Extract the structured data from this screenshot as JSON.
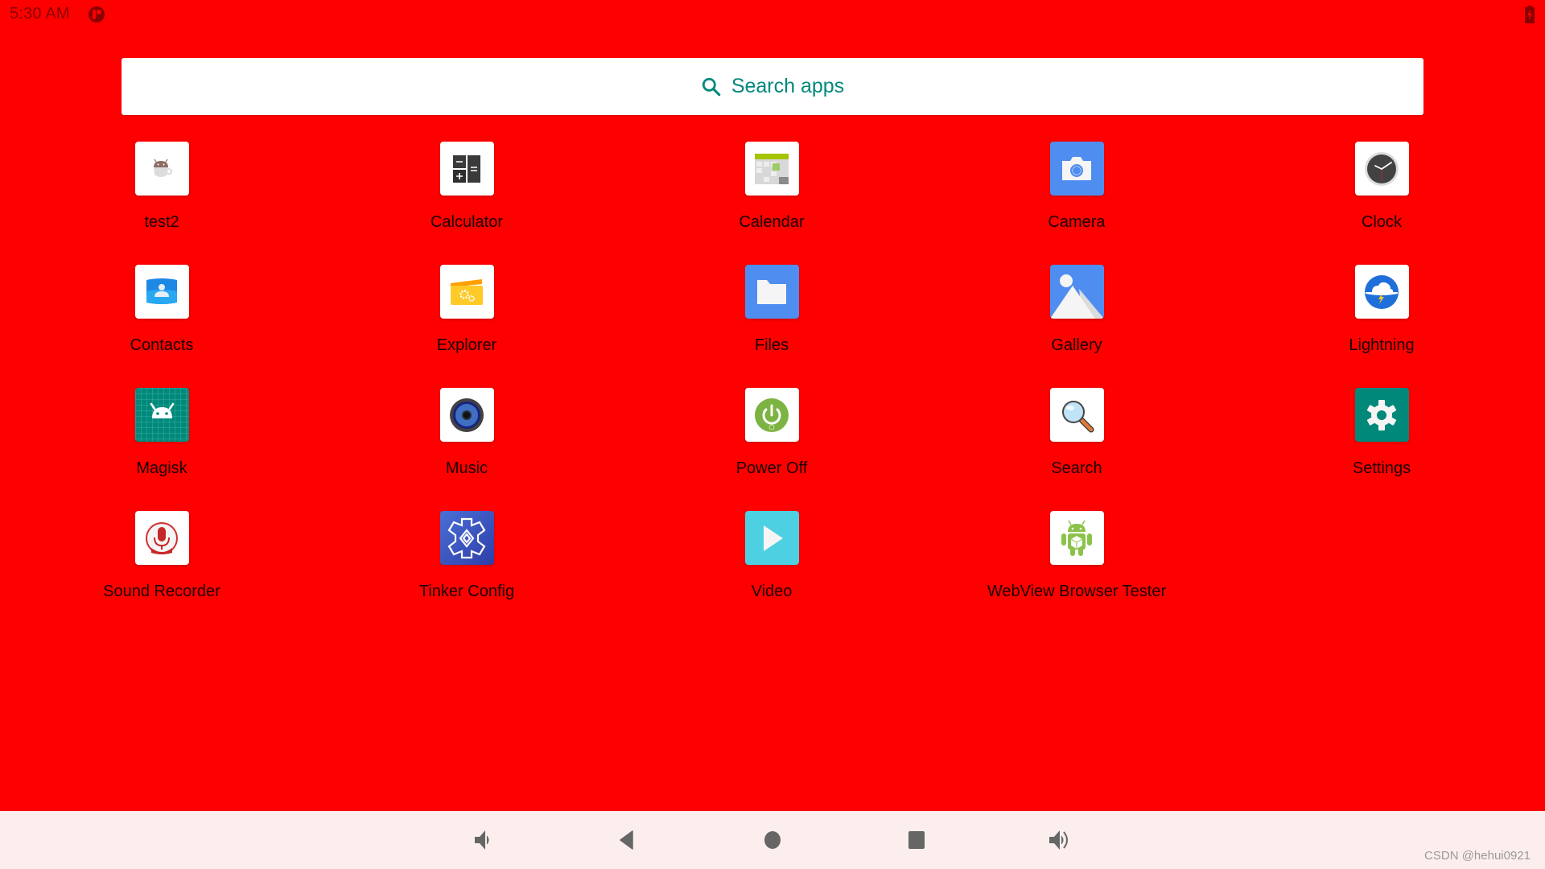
{
  "status_bar": {
    "time": "5:30 AM",
    "notification_icon": "app-notification-icon",
    "battery_icon": "battery-charging-icon"
  },
  "search": {
    "label": "Search apps",
    "icon": "search-icon"
  },
  "apps": [
    {
      "label": "test2",
      "icon": "android-cup-icon"
    },
    {
      "label": "Calculator",
      "icon": "calculator-icon"
    },
    {
      "label": "Calendar",
      "icon": "calendar-icon"
    },
    {
      "label": "Camera",
      "icon": "camera-icon"
    },
    {
      "label": "Clock",
      "icon": "clock-icon"
    },
    {
      "label": "Contacts",
      "icon": "contacts-icon"
    },
    {
      "label": "Explorer",
      "icon": "explorer-folder-icon"
    },
    {
      "label": "Files",
      "icon": "files-icon"
    },
    {
      "label": "Gallery",
      "icon": "gallery-icon"
    },
    {
      "label": "Lightning",
      "icon": "lightning-icon"
    },
    {
      "label": "Magisk",
      "icon": "magisk-icon"
    },
    {
      "label": "Music",
      "icon": "music-speaker-icon"
    },
    {
      "label": "Power Off",
      "icon": "power-icon"
    },
    {
      "label": "Search",
      "icon": "magnifier-icon"
    },
    {
      "label": "Settings",
      "icon": "settings-gear-icon"
    },
    {
      "label": "Sound Recorder",
      "icon": "microphone-icon"
    },
    {
      "label": "Tinker Config",
      "icon": "tinker-config-icon"
    },
    {
      "label": "Video",
      "icon": "video-play-icon"
    },
    {
      "label": "WebView Browser Tester",
      "icon": "android-robot-icon"
    }
  ],
  "nav_bar": {
    "buttons": [
      "volume-down",
      "back",
      "home",
      "recents",
      "volume-up"
    ]
  },
  "watermark": "CSDN @hehui0921",
  "colors": {
    "background": "#ff0000",
    "search_accent": "#00897b",
    "nav_background": "#fdeeee",
    "nav_icon": "#666666"
  }
}
